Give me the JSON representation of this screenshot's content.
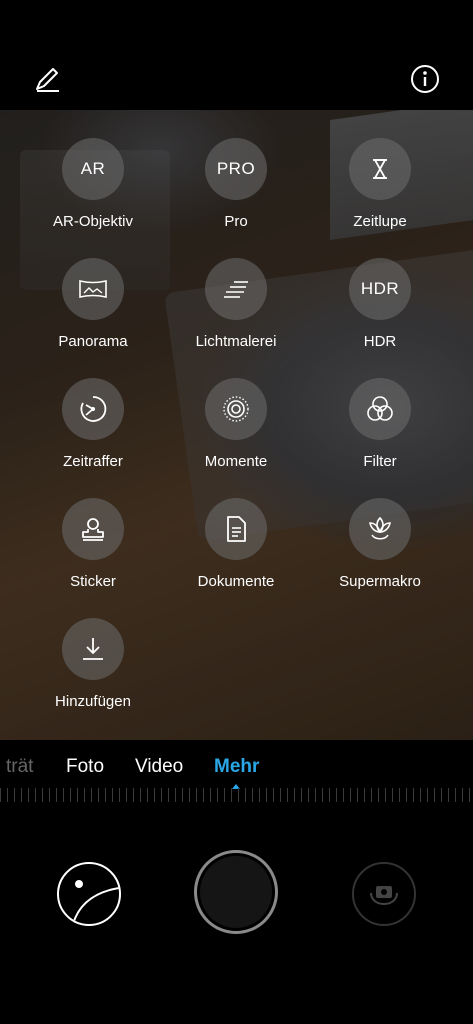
{
  "topbar": {
    "edit_icon": "pencil-icon",
    "info_icon": "info-icon"
  },
  "modes": [
    {
      "label": "AR-Objektiv",
      "icon_text": "AR",
      "icon": "ar-lens-icon"
    },
    {
      "label": "Pro",
      "icon_text": "PRO",
      "icon": "pro-icon"
    },
    {
      "label": "Zeitlupe",
      "icon": "hourglass-icon"
    },
    {
      "label": "Panorama",
      "icon": "panorama-icon"
    },
    {
      "label": "Lichtmalerei",
      "icon": "light-painting-icon"
    },
    {
      "label": "HDR",
      "icon_text": "HDR",
      "icon": "hdr-icon"
    },
    {
      "label": "Zeitraffer",
      "icon": "timelapse-icon"
    },
    {
      "label": "Momente",
      "icon": "moments-icon"
    },
    {
      "label": "Filter",
      "icon": "filter-icon"
    },
    {
      "label": "Sticker",
      "icon": "sticker-icon"
    },
    {
      "label": "Dokumente",
      "icon": "document-icon"
    },
    {
      "label": "Supermakro",
      "icon": "macro-flower-icon"
    },
    {
      "label": "Hinzufügen",
      "icon": "download-icon"
    }
  ],
  "tabs": [
    {
      "label": "trät",
      "state": "faded"
    },
    {
      "label": "Foto",
      "state": "normal"
    },
    {
      "label": "Video",
      "state": "normal"
    },
    {
      "label": "Mehr",
      "state": "active"
    }
  ],
  "colors": {
    "accent": "#2aa7e6",
    "background": "#000000"
  }
}
